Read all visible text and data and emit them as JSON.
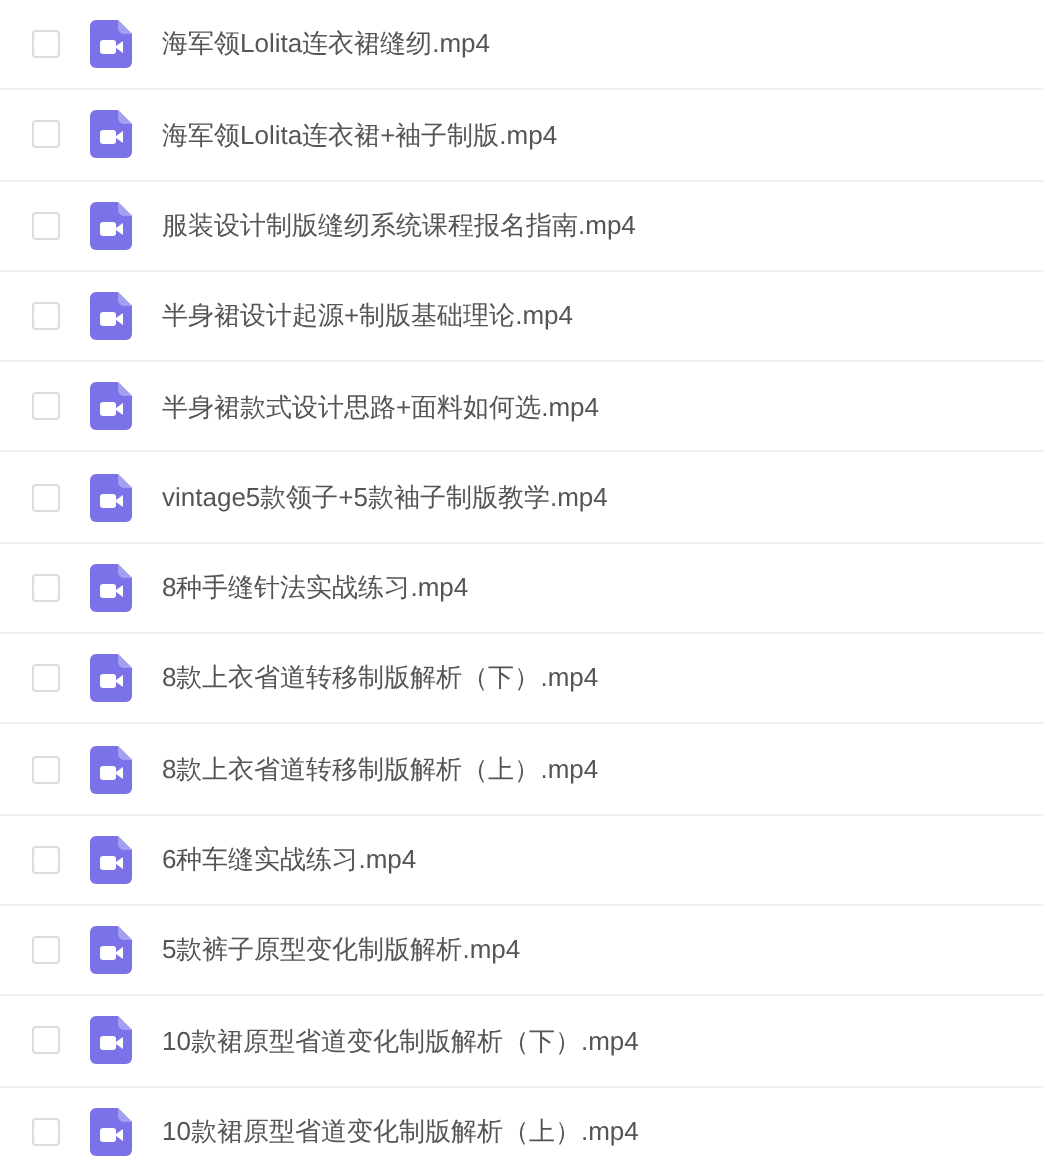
{
  "files": [
    {
      "name": "海军领Lolita连衣裙缝纫.mp4",
      "checked": false
    },
    {
      "name": "海军领Lolita连衣裙+袖子制版.mp4",
      "checked": false
    },
    {
      "name": "服装设计制版缝纫系统课程报名指南.mp4",
      "checked": false
    },
    {
      "name": "半身裙设计起源+制版基础理论.mp4",
      "checked": false
    },
    {
      "name": "半身裙款式设计思路+面料如何选.mp4",
      "checked": false
    },
    {
      "name": "vintage5款领子+5款袖子制版教学.mp4",
      "checked": false
    },
    {
      "name": "8种手缝针法实战练习.mp4",
      "checked": false
    },
    {
      "name": "8款上衣省道转移制版解析（下）.mp4",
      "checked": false
    },
    {
      "name": "8款上衣省道转移制版解析（上）.mp4",
      "checked": false
    },
    {
      "name": "6种车缝实战练习.mp4",
      "checked": false
    },
    {
      "name": "5款裤子原型变化制版解析.mp4",
      "checked": false
    },
    {
      "name": "10款裙原型省道变化制版解析（下）.mp4",
      "checked": false
    },
    {
      "name": "10款裙原型省道变化制版解析（上）.mp4",
      "checked": false
    }
  ]
}
